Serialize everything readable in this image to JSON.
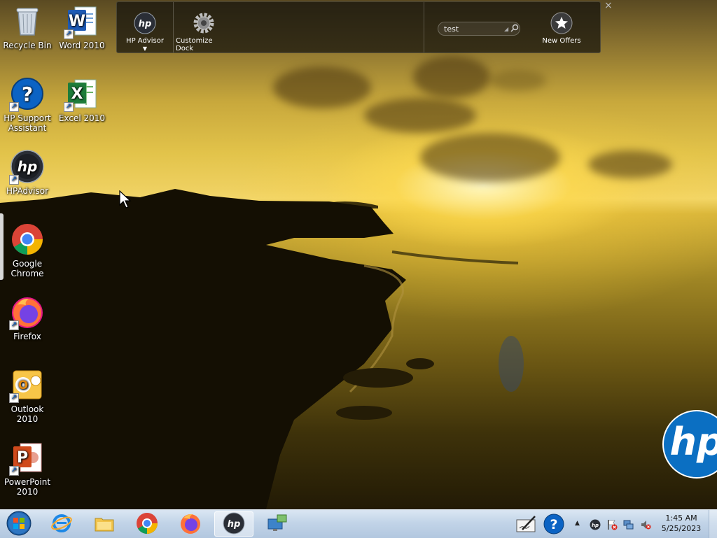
{
  "desktop": {
    "icons": [
      {
        "label": "Recycle Bin",
        "icon": "recycle-bin-icon"
      },
      {
        "label": "Word 2010",
        "icon": "word-icon"
      },
      {
        "label": "HP Support Assistant",
        "icon": "help-icon"
      },
      {
        "label": "Excel 2010",
        "icon": "excel-icon"
      },
      {
        "label": "HPAdvisor",
        "icon": "hp-logo-icon"
      },
      {
        "label": "Google Chrome",
        "icon": "chrome-icon"
      },
      {
        "label": "Firefox",
        "icon": "firefox-icon"
      },
      {
        "label": "Outlook 2010",
        "icon": "outlook-icon"
      },
      {
        "label": "PowerPoint 2010",
        "icon": "powerpoint-icon"
      }
    ]
  },
  "dock": {
    "items": [
      {
        "label": "HP Advisor",
        "icon": "hp-logo-icon"
      },
      {
        "label": "Customize Dock",
        "icon": "gear-icon"
      },
      {
        "label": "New Offers",
        "icon": "star-icon"
      }
    ],
    "search": {
      "value": "test"
    },
    "close_glyph": "×"
  },
  "taskbar": {
    "buttons": [
      {
        "icon": "start-orb-icon"
      },
      {
        "icon": "internet-explorer-icon"
      },
      {
        "icon": "file-explorer-icon"
      },
      {
        "icon": "chrome-icon"
      },
      {
        "icon": "firefox-icon"
      },
      {
        "icon": "hp-logo-icon",
        "active": true
      },
      {
        "icon": "remote-desktop-icon"
      }
    ],
    "tray": [
      "pen-input-icon",
      "help-icon",
      "chevron-up-icon",
      "hp-logo-icon",
      "flag-icon",
      "network-icon",
      "volume-muted-icon"
    ]
  },
  "clock": {
    "time": "1:45 AM",
    "date": "5/25/2023"
  },
  "watermark": {
    "logo_text": "hp"
  },
  "colors": {
    "accent_blue": "#0b6fc2",
    "taskbar": "#c2d4e8"
  }
}
